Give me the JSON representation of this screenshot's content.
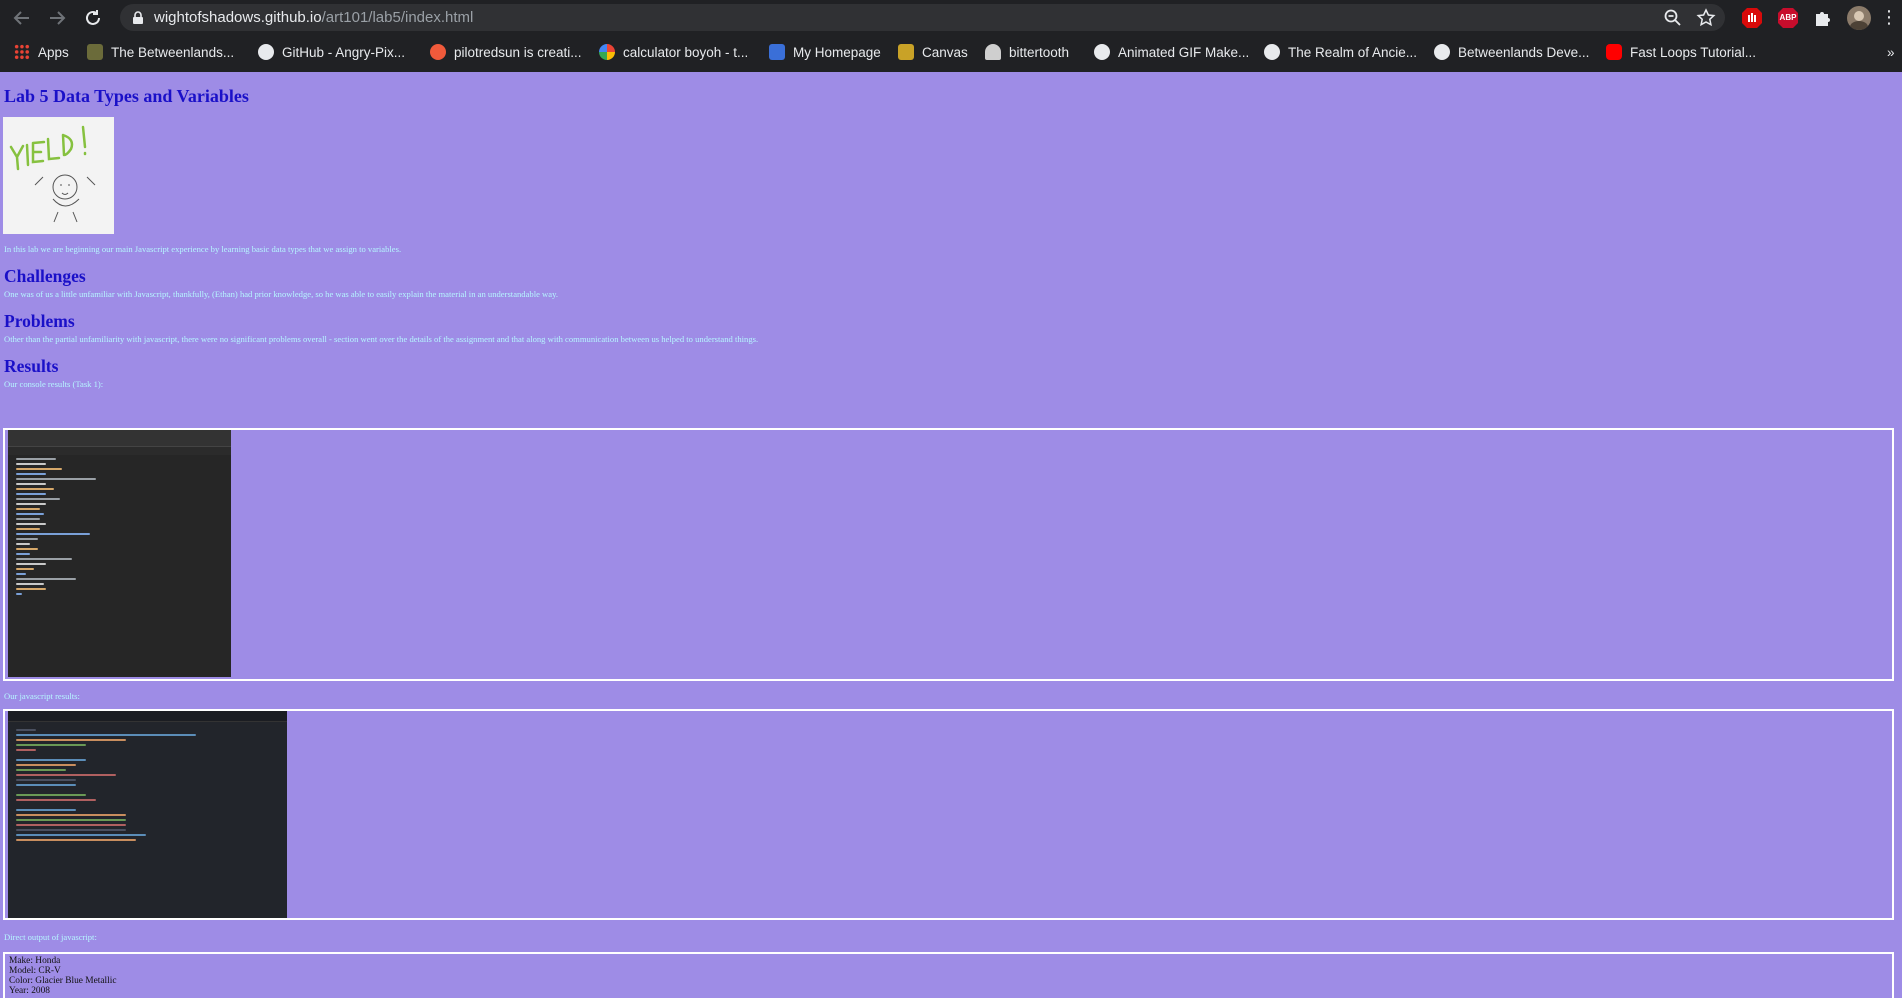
{
  "browser": {
    "url_host": "wightofshadows.github.io",
    "url_path": "/art101/lab5/index.html",
    "nav": {
      "back": "back-arrow-icon",
      "forward": "forward-arrow-icon",
      "reload": "reload-icon"
    },
    "extensions": [
      "adblock-icon",
      "abp-icon",
      "puzzle-icon",
      "profile-avatar"
    ],
    "extension_labels": {
      "abp": "ABP"
    },
    "bookmarks": [
      {
        "label": "Apps",
        "icon": "apps-grid-icon",
        "color": "#e8a200"
      },
      {
        "label": "The Betweenlands...",
        "icon": "betweenlands-icon",
        "color": "#6b6b3a"
      },
      {
        "label": "GitHub - Angry-Pix...",
        "icon": "github-icon",
        "color": "#e8eaed"
      },
      {
        "label": "pilotredsun is creati...",
        "icon": "patreon-icon",
        "color": "#f05a3b"
      },
      {
        "label": "calculator boyoh - t...",
        "icon": "google-icon",
        "color": "#ffffff"
      },
      {
        "label": "My Homepage",
        "icon": "homepage-icon",
        "color": "#3a6fd8"
      },
      {
        "label": "Canvas",
        "icon": "canvas-icon",
        "color": "#c9a227"
      },
      {
        "label": "bittertooth",
        "icon": "bittertooth-icon",
        "color": "#cfcfcf"
      },
      {
        "label": "Animated GIF Make...",
        "icon": "globe-icon",
        "color": "#e8eaed"
      },
      {
        "label": "The Realm of Ancie...",
        "icon": "globe-icon",
        "color": "#e8eaed"
      },
      {
        "label": "Betweenlands Deve...",
        "icon": "github-icon",
        "color": "#e8eaed"
      },
      {
        "label": "Fast Loops Tutorial...",
        "icon": "youtube-icon",
        "color": "#ff0000"
      }
    ],
    "overflow": "»"
  },
  "page": {
    "title": "Lab 5 Data Types and Variables",
    "intro": "In this lab we are beginning our main Javascript experience by learning basic data types that we assign to variables.",
    "challenges_heading": "Challenges",
    "challenges_text": "One was of us a little unfamiliar with Javascript, thankfully, (Ethan) had prior knowledge, so he was able to easily explain the material in an understandable way.",
    "problems_heading": "Problems",
    "problems_text": "Other than the partial unfamiliarity with javascript, there were no significant problems overall - section went over the details of the assignment and that along with communication between us helped to understand things.",
    "results_heading": "Results",
    "console_caption": "Our console results (Task 1):",
    "js_caption": "Our javascript results:",
    "direct_caption": "Direct output of javascript:",
    "output_lines": [
      "Make: Honda",
      "Model: CR-V",
      "Color: Glacier Blue Metallic",
      "Year: 2008"
    ]
  },
  "colors": {
    "background": "#9e8ce6",
    "heading": "#1a10c8",
    "text": "#b6f6ff",
    "border": "#ffffff"
  }
}
